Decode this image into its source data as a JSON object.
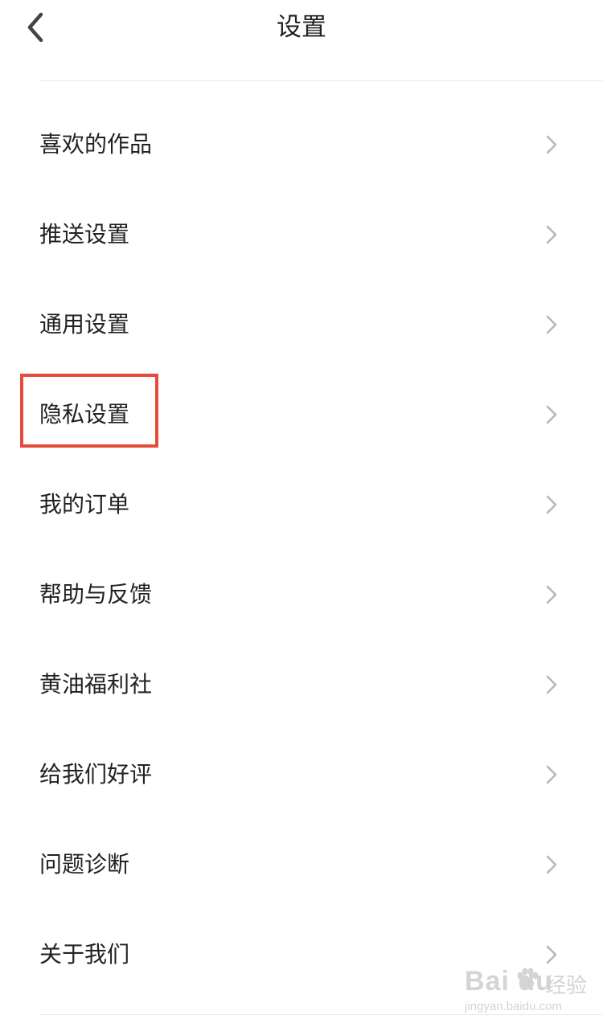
{
  "header": {
    "title": "设置"
  },
  "menu": {
    "items": [
      {
        "label": "喜欢的作品"
      },
      {
        "label": "推送设置"
      },
      {
        "label": "通用设置"
      },
      {
        "label": "隐私设置"
      },
      {
        "label": "我的订单"
      },
      {
        "label": "帮助与反馈"
      },
      {
        "label": "黄油福利社"
      },
      {
        "label": "给我们好评"
      },
      {
        "label": "问题诊断"
      },
      {
        "label": "关于我们"
      }
    ]
  },
  "highlight": {
    "target": "隐私设置",
    "color": "#e64b3c"
  },
  "watermark": {
    "brand_latin": "Bai  du",
    "brand_cn": "经验",
    "url": "jingyan.baidu.com"
  },
  "icons": {
    "back": "chevron-left-icon",
    "row_arrow": "chevron-right-icon"
  },
  "colors": {
    "text": "#222222",
    "chevron": "#b8b8b8",
    "divider": "#ececec",
    "highlight": "#e64b3c"
  }
}
